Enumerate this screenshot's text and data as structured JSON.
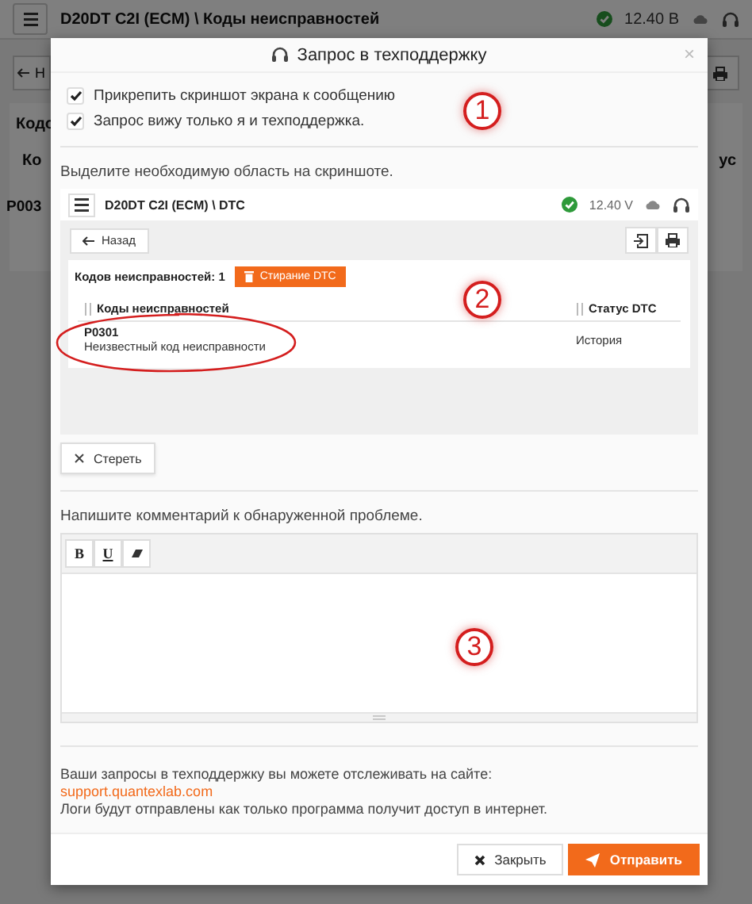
{
  "background": {
    "breadcrumb": "D20DT C2I (ECM) \\ Коды неисправностей",
    "voltage": "12.40 В",
    "back_fragment": "Н",
    "count_fragment": "Кодо",
    "column_fragment_left": "Ко",
    "column_fragment_right": "ус",
    "row_fragment": "P003"
  },
  "dialog": {
    "title": "Запрос в техподдержку",
    "close": "×",
    "options": [
      {
        "label": "Прикрепить скриншот экрана к сообщению",
        "checked": true
      },
      {
        "label": "Запрос вижу только я и техподдержка.",
        "checked": true
      }
    ],
    "options_marker": "1",
    "screenshot_hint": "Выделите необходимую область на скриншоте.",
    "screenshot": {
      "breadcrumb": "D20DT C2I (ECM) \\ DTC",
      "connected": true,
      "voltage": "12.40 V",
      "back": "Назад",
      "count_label": "Кодов неисправностей: 1",
      "erase_dtc": "Стирание DTC",
      "columns": [
        "Коды неисправностей",
        "Статус DTC"
      ],
      "rows": [
        {
          "code": "P0301",
          "description": "Неизвестный код неисправности",
          "status": "История",
          "highlighted": true
        }
      ],
      "marker": "2"
    },
    "clear_button": "Стереть",
    "comment_label": "Напишите комментарий к обнаруженной проблеме.",
    "editor": {
      "tools": [
        {
          "kind": "bold",
          "label": "B"
        },
        {
          "kind": "underline",
          "label": "U"
        },
        {
          "kind": "eraser"
        }
      ],
      "marker": "3"
    },
    "info": [
      {
        "kind": "text",
        "text": "Ваши запросы в техподдержку вы можете отслеживать на сайте:"
      },
      {
        "kind": "link",
        "text": "support.quantexlab.com"
      },
      {
        "kind": "text",
        "text": "Логи будут отправлены как только программа получит доступ в интернет."
      }
    ],
    "buttons": [
      {
        "kind": "secondary",
        "label": "Закрыть"
      },
      {
        "kind": "primary",
        "label": "Отправить"
      }
    ]
  }
}
